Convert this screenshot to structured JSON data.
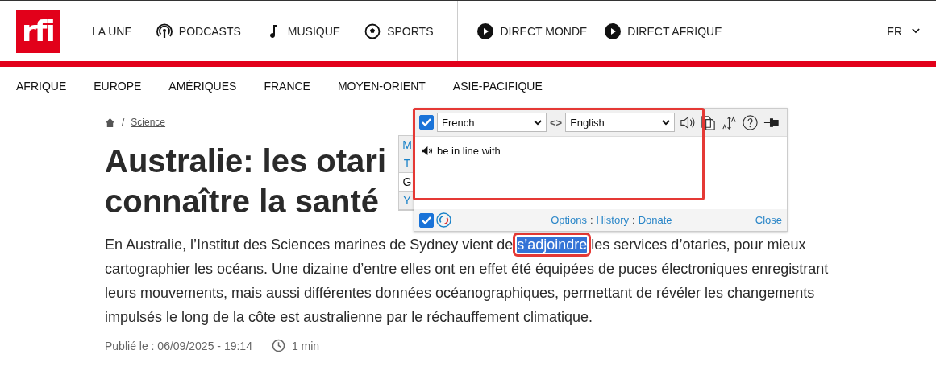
{
  "header": {
    "logo": "rfi",
    "nav": [
      {
        "label": "LA UNE"
      },
      {
        "label": "PODCASTS"
      },
      {
        "label": "MUSIQUE"
      },
      {
        "label": "SPORTS"
      }
    ],
    "live": [
      {
        "label": "DIRECT MONDE"
      },
      {
        "label": "DIRECT AFRIQUE"
      }
    ],
    "language": "FR"
  },
  "regions": [
    "AFRIQUE",
    "EUROPE",
    "AMÉRIQUES",
    "FRANCE",
    "MOYEN-ORIENT",
    "ASIE-PACIFIQUE"
  ],
  "breadcrumb": {
    "separator": "/",
    "section": "Science"
  },
  "title_lines": [
    "Australie: les otari",
    "connaître la santé"
  ],
  "paragraph": {
    "before": "En Australie, l’Institut des Sciences marines de Sydney vient de",
    "selected": "s’adjoindre",
    "after": "les services d’otaries, pour mieux cartographier les océans. Une dizaine d’entre elles ont en effet été équipées de puces électroniques enregistrant leurs mouvements, mais aussi différentes données océanographiques, permettant de révéler les changements impulsés le long de la côte est australienne par le réchauffement climatique."
  },
  "meta": {
    "published": "Publié le : 06/09/2025 - 19:14",
    "read_time": "1 min"
  },
  "translator": {
    "enabled": true,
    "source": "French",
    "swap": "<>",
    "target": "English",
    "result": "be in line with",
    "side_tabs": [
      {
        "label": "M",
        "selected": false
      },
      {
        "label": "T",
        "selected": false
      },
      {
        "label": "G",
        "selected": true
      },
      {
        "label": "Y",
        "selected": false
      }
    ],
    "footer_checked": true,
    "links": [
      "Options",
      "History",
      "Donate"
    ],
    "link_separator": ":",
    "close": "Close"
  }
}
